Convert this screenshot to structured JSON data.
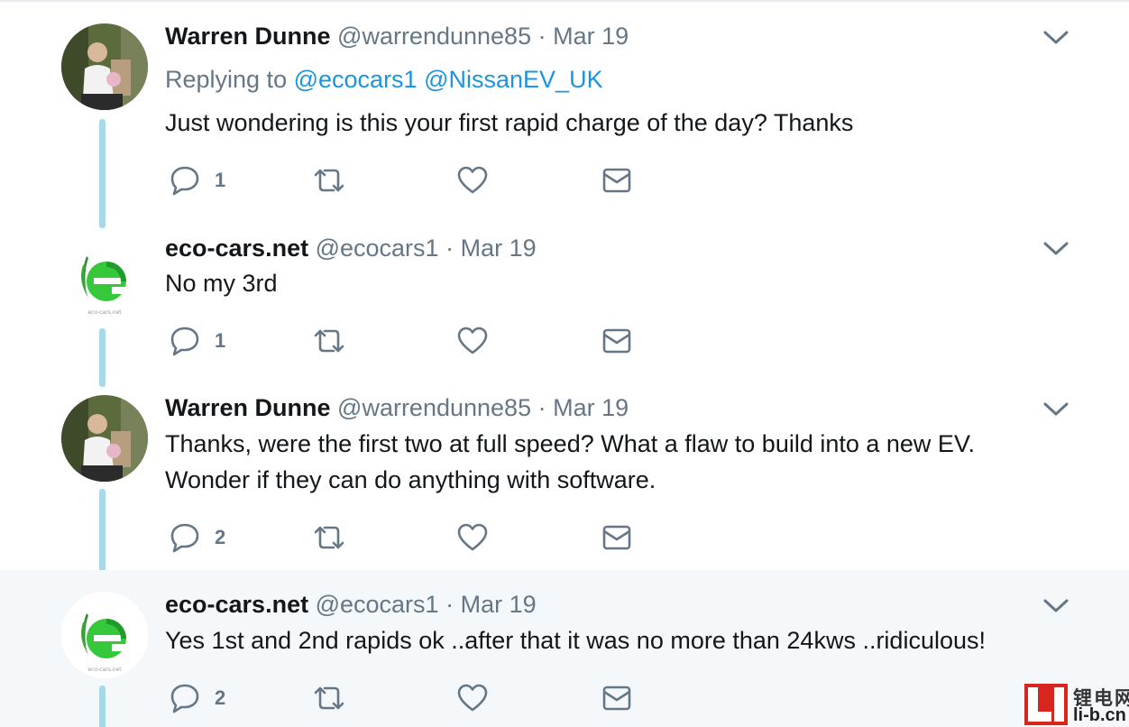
{
  "icons": {
    "reply": "reply-icon",
    "retweet": "retweet-icon",
    "like": "heart-icon",
    "dm": "mail-icon",
    "menu": "chevron-down-icon"
  },
  "colors": {
    "link": "#1b95e0",
    "muted": "#657786",
    "thread_line": "#a8d9e8",
    "highlight_bg": "#f5f8fa",
    "eco_green": "#34c83a"
  },
  "tweets": [
    {
      "name": "Warren Dunne",
      "handle": "@warrendunne85",
      "separator": "·",
      "date": "Mar 19",
      "replying_label": "Replying to",
      "mention_1": "@ecocars1",
      "mention_2": "@NissanEV_UK",
      "text": "Just wondering is this your first rapid charge of the day? Thanks",
      "reply_count": "1"
    },
    {
      "name": "eco-cars.net",
      "handle": "@ecocars1",
      "separator": "·",
      "date": "Mar 19",
      "text": "No my 3rd",
      "reply_count": "1",
      "avatar_caption": "eco-cars.net"
    },
    {
      "name": "Warren Dunne",
      "handle": "@warrendunne85",
      "separator": "·",
      "date": "Mar 19",
      "text_line_1": "Thanks, were the first two at full speed? What a flaw to build into a new EV.",
      "text_line_2": "Wonder if they can do anything with software.",
      "reply_count": "2"
    },
    {
      "name": "eco-cars.net",
      "handle": "@ecocars1",
      "separator": "·",
      "date": "Mar 19",
      "text": "Yes 1st and 2nd rapids ok ..after that it was no more than 24kws ..ridiculous!",
      "reply_count": "2",
      "avatar_caption": "eco-cars.net"
    }
  ],
  "watermark": {
    "logo_letters": "LI",
    "chinese": "锂电网",
    "domain": "li-b.cn"
  }
}
